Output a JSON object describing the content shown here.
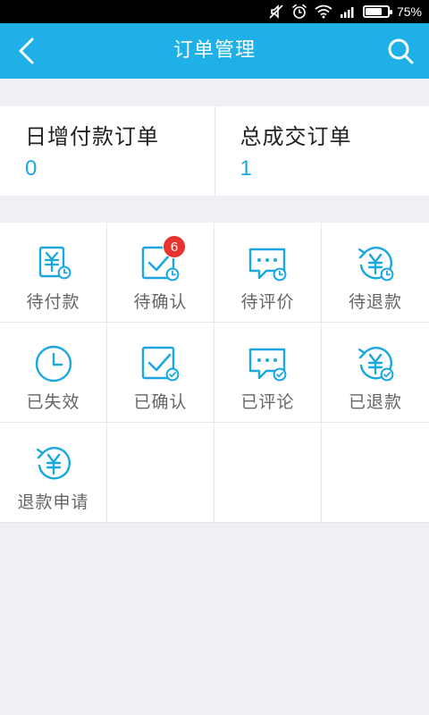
{
  "status_bar": {
    "battery_percent": "75%",
    "battery_level": 0.75,
    "icons": [
      "mute-icon",
      "alarm-icon",
      "wifi-icon",
      "signal-icon",
      "battery-icon"
    ]
  },
  "header": {
    "title": "订单管理",
    "back_icon": "chevron-left-icon",
    "search_icon": "search-icon",
    "background_color": "#1fb0e8"
  },
  "stats": [
    {
      "label": "日增付款订单",
      "value": "0"
    },
    {
      "label": "总成交订单",
      "value": "1"
    }
  ],
  "accent_color": "#1ba7e0",
  "badge_color": "#e8332f",
  "menu": [
    {
      "label": "待付款",
      "icon": "pay-pending-icon"
    },
    {
      "label": "待确认",
      "icon": "confirm-pending-icon",
      "badge": "6"
    },
    {
      "label": "待评价",
      "icon": "review-pending-icon"
    },
    {
      "label": "待退款",
      "icon": "refund-pending-icon"
    },
    {
      "label": "已失效",
      "icon": "expired-clock-icon"
    },
    {
      "label": "已确认",
      "icon": "confirmed-icon"
    },
    {
      "label": "已评论",
      "icon": "reviewed-icon"
    },
    {
      "label": "已退款",
      "icon": "refunded-icon"
    },
    {
      "label": "退款申请",
      "icon": "refund-request-icon"
    }
  ]
}
